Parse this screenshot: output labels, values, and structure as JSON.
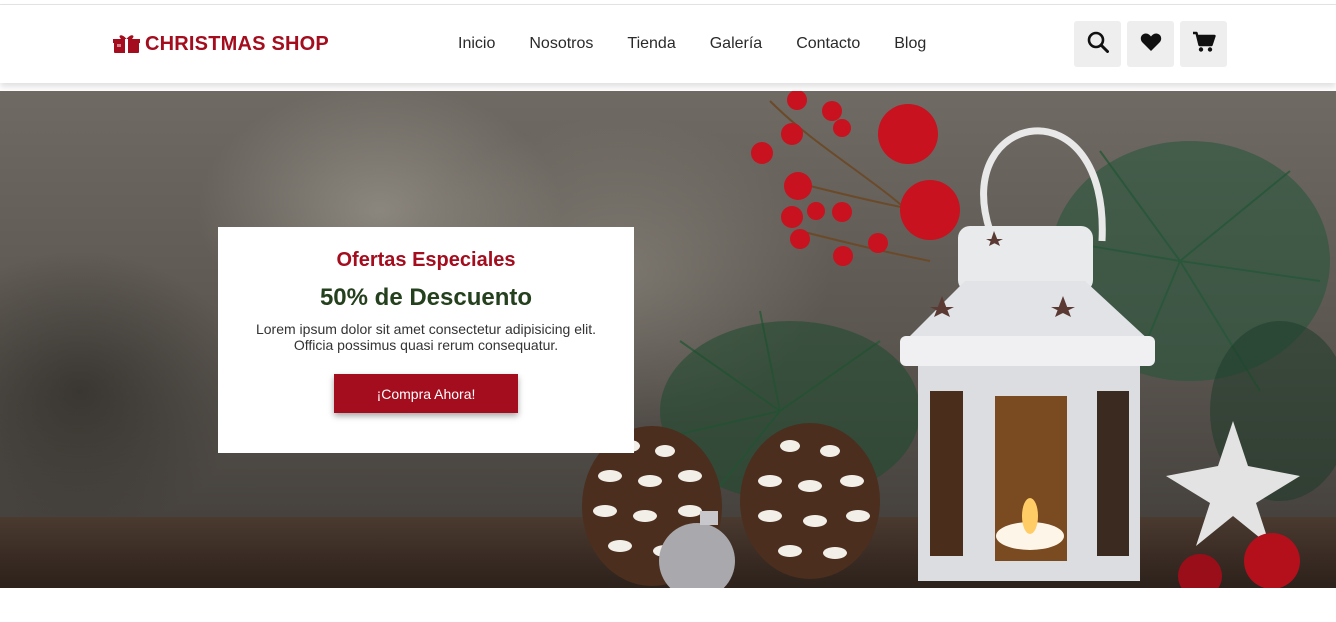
{
  "header": {
    "logo_text": "CHRISTMAS SHOP",
    "logo_icon": "gift-icon",
    "nav": [
      {
        "label": "Inicio"
      },
      {
        "label": "Nosotros"
      },
      {
        "label": "Tienda"
      },
      {
        "label": "Galería"
      },
      {
        "label": "Contacto"
      },
      {
        "label": "Blog"
      }
    ],
    "actions": [
      "search-icon",
      "heart-icon",
      "cart-icon"
    ]
  },
  "hero": {
    "kicker": "Ofertas Especiales",
    "title": "50% de Descuento",
    "text": "Lorem ipsum dolor sit amet consectetur adipisicing elit. Officia possimus quasi rerum consequatur.",
    "cta_label": "¡Compra Ahora!"
  },
  "colors": {
    "brand": "#a30d1e",
    "title_green": "#24401d",
    "icon_button_bg": "#eeeeee"
  }
}
